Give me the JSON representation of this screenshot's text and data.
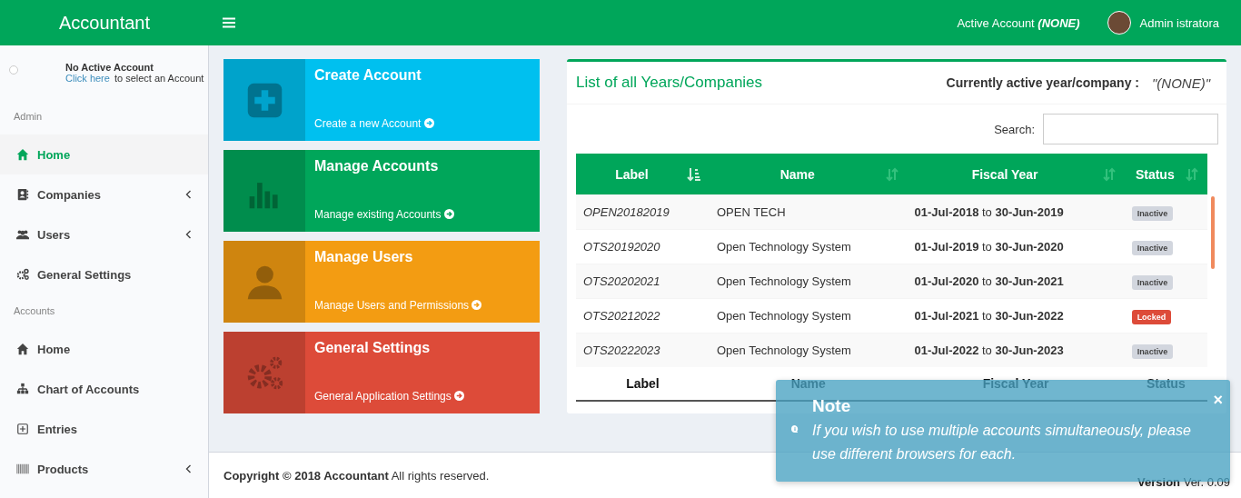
{
  "header": {
    "brand": "Accountant",
    "active_account_label": "Active Account",
    "active_account_value": "(NONE)",
    "user_name": "Admin istratora"
  },
  "sidebar": {
    "user_panel": {
      "title": "No Active Account",
      "link": "Click here",
      "text": "to select an Account"
    },
    "sections": [
      {
        "heading": "Admin",
        "items": [
          {
            "label": "Home",
            "selected": true,
            "expandable": false
          },
          {
            "label": "Companies",
            "selected": false,
            "expandable": true
          },
          {
            "label": "Users",
            "selected": false,
            "expandable": true
          },
          {
            "label": "General Settings",
            "selected": false,
            "expandable": false
          }
        ]
      },
      {
        "heading": "Accounts",
        "items": [
          {
            "label": "Home",
            "selected": false,
            "expandable": false
          },
          {
            "label": "Chart of Accounts",
            "selected": false,
            "expandable": false
          },
          {
            "label": "Entries",
            "selected": false,
            "expandable": false
          },
          {
            "label": "Products",
            "selected": false,
            "expandable": true
          }
        ]
      }
    ]
  },
  "tiles": [
    {
      "title": "Create Account",
      "link": "Create a new Account",
      "color": "#00c0ef"
    },
    {
      "title": "Manage Accounts",
      "link": "Manage existing Accounts",
      "color": "#00a65a"
    },
    {
      "title": "Manage Users",
      "link": "Manage Users and Permissions",
      "color": "#f39c12"
    },
    {
      "title": "General Settings",
      "link": "General Application Settings",
      "color": "#dd4b39"
    }
  ],
  "panel": {
    "title": "List of all Years/Companies",
    "active_label": "Currently active year/company :",
    "active_value": "\"(NONE)\"",
    "search_label": "Search:",
    "table": {
      "columns": [
        {
          "label": "Label",
          "sorted": true
        },
        {
          "label": "Name",
          "sorted": false
        },
        {
          "label": "Fiscal Year",
          "sorted": false
        },
        {
          "label": "Status",
          "sorted": false
        }
      ],
      "rows": [
        {
          "label": "OPEN20182019",
          "name": "OPEN TECH",
          "fiscal_year": "**01-Jul-2018** to **30-Jun-2019**",
          "status": "Inactive",
          "kind": "inactive"
        },
        {
          "label": "OTS20192020",
          "name": "Open Technology System",
          "fiscal_year": "**01-Jul-2019** to **30-Jun-2020**",
          "status": "Inactive",
          "kind": "inactive"
        },
        {
          "label": "OTS20202021",
          "name": "Open Technology System",
          "fiscal_year": "**01-Jul-2020** to **30-Jun-2021**",
          "status": "Inactive",
          "kind": "inactive"
        },
        {
          "label": "OTS20212022",
          "name": "Open Technology System",
          "fiscal_year": "**01-Jul-2021** to **30-Jun-2022**",
          "status": "Locked",
          "kind": "locked"
        },
        {
          "label": "OTS20222023",
          "name": "Open Technology System",
          "fiscal_year": "**01-Jul-2022** to **30-Jun-2023**",
          "status": "Inactive",
          "kind": "inactive"
        }
      ],
      "footer_columns": [
        "Label",
        "Name",
        "Fiscal Year",
        "Status"
      ]
    }
  },
  "footer": {
    "copyright": "**Copyright © 2018 Accountant** All rights reserved.",
    "version": "**Version** Ver. 0.09"
  },
  "notification": {
    "title": "Note",
    "message": "If you wish to use multiple accounts simultaneously, please use different browsers for each.",
    "close": "×"
  }
}
